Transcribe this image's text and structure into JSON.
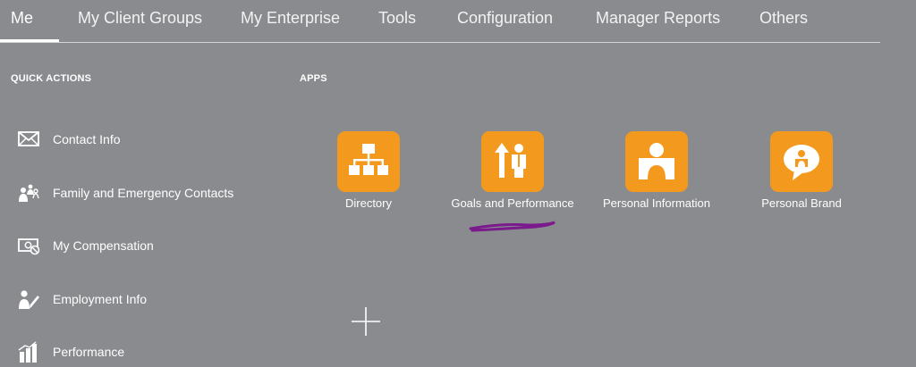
{
  "nav": {
    "tabs": [
      {
        "label": "Me"
      },
      {
        "label": "My Client Groups"
      },
      {
        "label": "My Enterprise"
      },
      {
        "label": "Tools"
      },
      {
        "label": "Configuration"
      },
      {
        "label": "Manager Reports"
      },
      {
        "label": "Others"
      }
    ]
  },
  "quick_actions": {
    "heading": "QUICK ACTIONS",
    "items": [
      {
        "label": "Contact Info",
        "icon": "envelope-icon"
      },
      {
        "label": "Family and Emergency Contacts",
        "icon": "people-icon"
      },
      {
        "label": "My Compensation",
        "icon": "money-icon"
      },
      {
        "label": "Employment Info",
        "icon": "person-edit-icon"
      },
      {
        "label": "Performance",
        "icon": "bar-chart-icon"
      }
    ]
  },
  "apps": {
    "heading": "APPS",
    "items": [
      {
        "label": "Directory",
        "icon": "org-chart-icon"
      },
      {
        "label": "Goals and Performance",
        "icon": "goals-icon"
      },
      {
        "label": "Personal Information",
        "icon": "person-badge-icon"
      },
      {
        "label": "Personal Brand",
        "icon": "speech-bubble-person-icon"
      }
    ]
  },
  "colors": {
    "background": "#898b8e",
    "tile": "#f39a1e",
    "annotation": "#7b1a8c"
  }
}
